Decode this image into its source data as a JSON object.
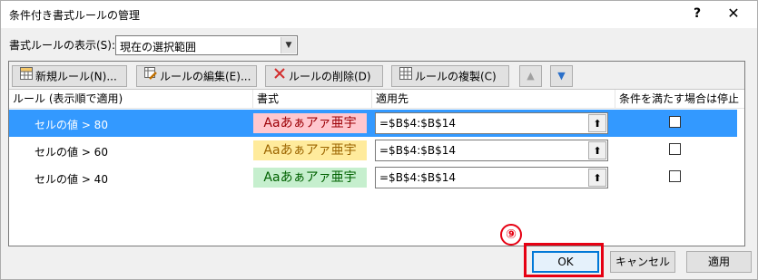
{
  "window": {
    "title": "条件付き書式ルールの管理",
    "help_label": "?",
    "close_label": "✕"
  },
  "scope": {
    "label": "書式ルールの表示(S):",
    "value": "現在の選択範囲"
  },
  "toolbar": {
    "new_rule": "新規ルール(N)...",
    "edit_rule": "ルールの編集(E)...",
    "delete_rule": "ルールの削除(D)",
    "duplicate_rule": "ルールの複製(C)",
    "move_up": "▲",
    "move_down": "▼"
  },
  "table": {
    "headers": [
      "ルール (表示順で適用)",
      "書式",
      "適用先",
      "条件を満たす場合は停止"
    ],
    "rows": [
      {
        "rule": "セルの値 > 80",
        "format_sample": "Aaあぁアァ亜宇",
        "fill": "#ffc7ce",
        "font_color": "#9c0006",
        "applies_to": "=$B$4:$B$14",
        "stop_if_true": false,
        "selected": true
      },
      {
        "rule": "セルの値 > 60",
        "format_sample": "Aaあぁアァ亜宇",
        "fill": "#ffeb9c",
        "font_color": "#9c6500",
        "applies_to": "=$B$4:$B$14",
        "stop_if_true": false,
        "selected": false
      },
      {
        "rule": "セルの値 > 40",
        "format_sample": "Aaあぁアァ亜宇",
        "fill": "#c6efce",
        "font_color": "#006100",
        "applies_to": "=$B$4:$B$14",
        "stop_if_true": false,
        "selected": false
      }
    ]
  },
  "annotation": {
    "step_marker": "⑨"
  },
  "buttons": {
    "ok": "OK",
    "cancel": "キャンセル",
    "apply": "適用"
  },
  "colors": {
    "selection": "#3399ff",
    "highlight": "#e60012",
    "ok_border": "#0078d7"
  }
}
